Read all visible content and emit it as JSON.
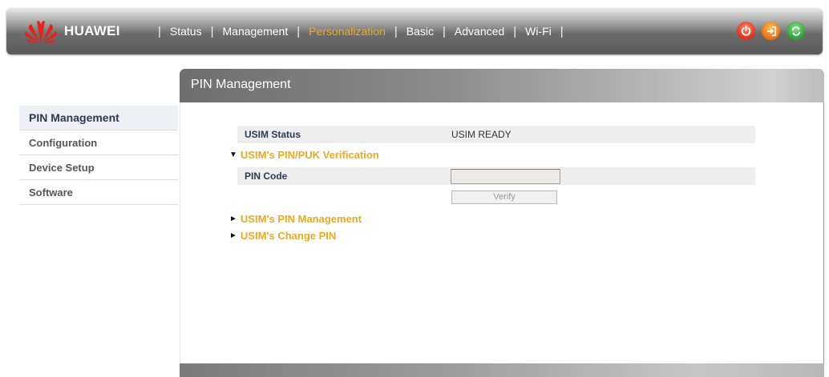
{
  "header": {
    "logo": {
      "brand": "HUAWEI",
      "icon": "huawei-logo-icon"
    },
    "nav": [
      {
        "label": "Status",
        "active": false
      },
      {
        "label": "Management",
        "active": false
      },
      {
        "label": "Personalization",
        "active": true
      },
      {
        "label": "Basic",
        "active": false
      },
      {
        "label": "Advanced",
        "active": false
      },
      {
        "label": "Wi-Fi",
        "active": false
      }
    ],
    "actions": [
      {
        "icon": "power-icon",
        "color": "#e0301a"
      },
      {
        "icon": "logout-icon",
        "color": "#ec6c10"
      },
      {
        "icon": "refresh-icon",
        "color": "#2e9e36"
      }
    ],
    "active_color": "#f0a81e"
  },
  "sidebar": {
    "items": [
      {
        "label": "PIN Management",
        "active": true
      },
      {
        "label": "Configuration",
        "active": false
      },
      {
        "label": "Device Setup",
        "active": false
      },
      {
        "label": "Software",
        "active": false
      }
    ]
  },
  "main": {
    "title": "PIN Management",
    "usim_status": {
      "label": "USIM Status",
      "value": "USIM READY"
    },
    "sections": {
      "verification": {
        "title": "USIM's PIN/PUK Verification",
        "expanded": true,
        "arrow": "▼"
      },
      "pin_management": {
        "title": "USIM's PIN Management",
        "expanded": false,
        "arrow": "►"
      },
      "change_pin": {
        "title": "USIM's Change PIN",
        "expanded": false,
        "arrow": "►"
      }
    },
    "pin_code": {
      "label": "PIN Code",
      "value": "",
      "placeholder": ""
    },
    "verify_button": "Verify"
  }
}
